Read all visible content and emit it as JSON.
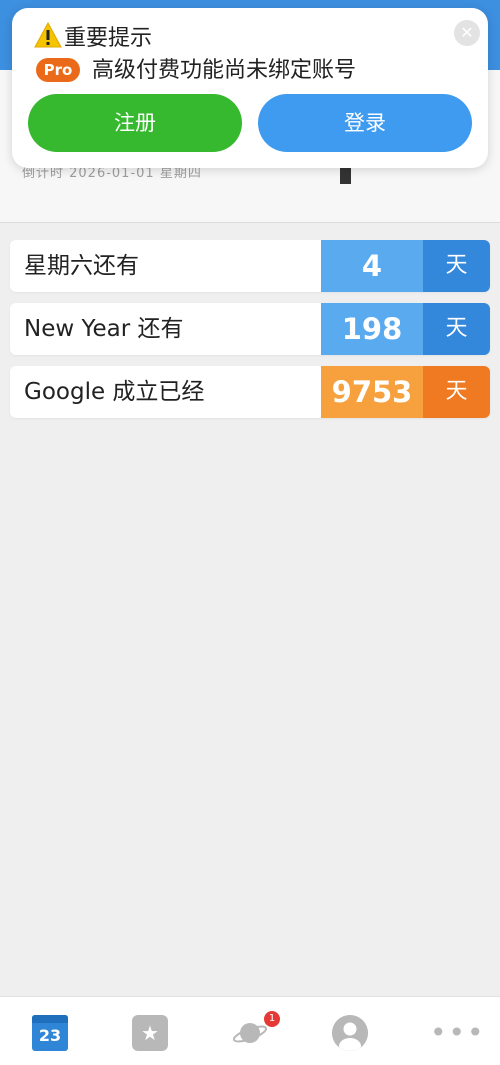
{
  "toast": {
    "title": "重要提示",
    "badge": "Pro",
    "message": "高级付费功能尚未绑定账号",
    "close_glyph": "✕",
    "register_label": "注册",
    "login_label": "登录",
    "icon": "warning-icon"
  },
  "header": {
    "partial_text": "倒计时 2026-01-01 星期四"
  },
  "rows": [
    {
      "label": "星期六还有",
      "value": "4",
      "unit": "天",
      "theme": "blue"
    },
    {
      "label": "New Year 还有",
      "value": "198",
      "unit": "天",
      "theme": "blue"
    },
    {
      "label": "Google 成立已经",
      "value": "9753",
      "unit": "天",
      "theme": "orange"
    }
  ],
  "tabbar": {
    "calendar_day": "23",
    "fav_glyph": "★",
    "more_glyph": "•••",
    "planet_badge": "1",
    "icons": [
      "calendar-icon",
      "favorite-icon",
      "planet-icon",
      "profile-icon",
      "more-icon"
    ]
  },
  "colors": {
    "accent_blue": "#3d8fe0",
    "register_green": "#36b92f",
    "login_blue": "#3f9bf0",
    "orange": "#f07a22",
    "badge_red": "#e53935"
  }
}
